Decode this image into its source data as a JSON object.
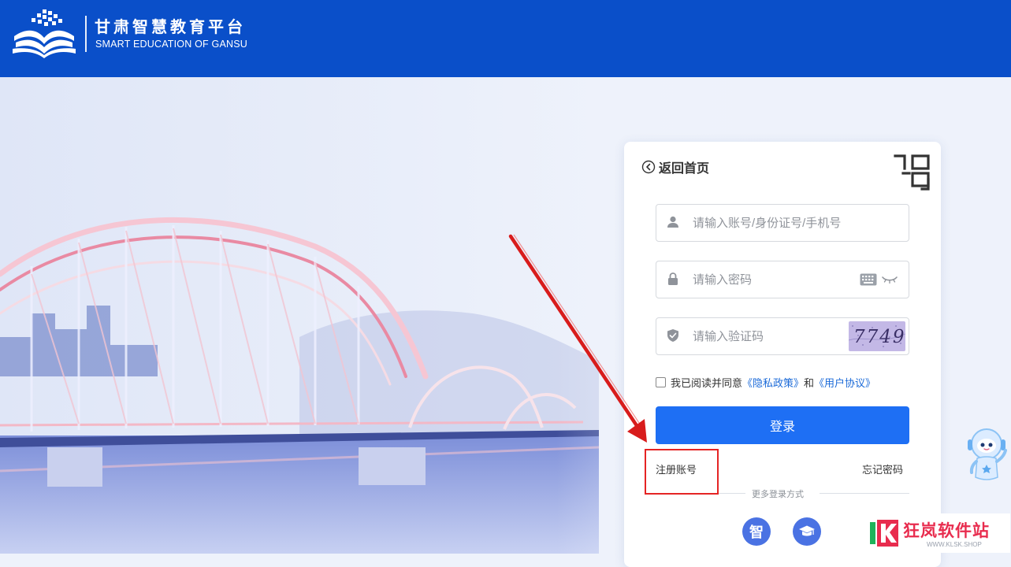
{
  "header": {
    "brand_cn": "甘肃智慧教育平台",
    "brand_en": "SMART EDUCATION OF GANSU",
    "logo_icon": "open-book-logo-icon",
    "background_color": "#0a4fc9"
  },
  "login_card": {
    "back_label": "返回首页",
    "back_icon": "chevron-left-circle-icon",
    "qr_icon": "qr-code-icon",
    "account": {
      "placeholder": "请输入账号/身份证号/手机号",
      "value": "",
      "icon": "user-icon"
    },
    "password": {
      "placeholder": "请输入密码",
      "value": "",
      "icon": "lock-icon",
      "keyboard_icon": "keyboard-icon",
      "eye_icon": "eye-closed-icon"
    },
    "captcha": {
      "placeholder": "请输入验证码",
      "value": "",
      "icon": "shield-icon",
      "image_text": "7749"
    },
    "agreement": {
      "checked": false,
      "prefix": "我已阅读并同意",
      "privacy_link": "《隐私政策》",
      "and": "和",
      "terms_link": "《用户协议》"
    },
    "login_button": "登录",
    "register_link": "注册账号",
    "forgot_link": "忘记密码",
    "more_methods": "更多登录方式",
    "alt_methods": [
      {
        "label": "智",
        "icon": "zhi-login-icon"
      },
      {
        "icon": "graduation-cap-icon"
      }
    ],
    "primary_color": "#1e6ff4"
  },
  "annotation": {
    "color": "#e52424",
    "icon": "red-arrow-icon"
  },
  "watermark": {
    "name": "狂岚软件站",
    "url": "WWW.KLSK.SHOP",
    "icon": "k-logo-icon"
  }
}
